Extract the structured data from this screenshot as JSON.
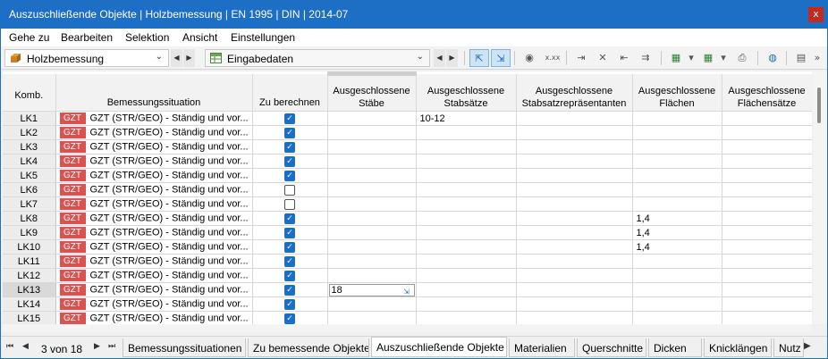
{
  "window": {
    "title": "Auszuschließende Objekte | Holzbemessung | EN 1995 | DIN | 2014-07",
    "close_label": "x"
  },
  "menu": [
    "Gehe zu",
    "Bearbeiten",
    "Selektion",
    "Ansicht",
    "Einstellungen"
  ],
  "toolbar": {
    "module_combo": "Holzbemessung",
    "view_combo": "Eingabedaten",
    "icons": {
      "module": "wood-beam-icon",
      "view": "table-icon",
      "overflow": "»"
    }
  },
  "table": {
    "headers": {
      "komb": "Komb.",
      "situation": "Bemessungssituation",
      "zu_berechnen": "Zu berechnen",
      "staebe": "Ausgeschlossene Stäbe",
      "stabsaetze": "Ausgeschlossene Stabsätze",
      "repraesentanten": "Ausgeschlossene Stabsatzrepräsentanten",
      "flaechen": "Ausgeschlossene Flächen",
      "flaechensaetze": "Ausgeschlossene Flächensätze"
    },
    "rows": [
      {
        "id": "LK1",
        "tag": "GZT",
        "desc": "GZT (STR/GEO) - Ständig und vor...",
        "checked": true,
        "staebe": "",
        "stabsaetze": "10-12",
        "rep": "",
        "flaechen": "",
        "fsaetze": ""
      },
      {
        "id": "LK2",
        "tag": "GZT",
        "desc": "GZT (STR/GEO) - Ständig und vor...",
        "checked": true,
        "staebe": "",
        "stabsaetze": "",
        "rep": "",
        "flaechen": "",
        "fsaetze": ""
      },
      {
        "id": "LK3",
        "tag": "GZT",
        "desc": "GZT (STR/GEO) - Ständig und vor...",
        "checked": true,
        "staebe": "",
        "stabsaetze": "",
        "rep": "",
        "flaechen": "",
        "fsaetze": ""
      },
      {
        "id": "LK4",
        "tag": "GZT",
        "desc": "GZT (STR/GEO) - Ständig und vor...",
        "checked": true,
        "staebe": "",
        "stabsaetze": "",
        "rep": "",
        "flaechen": "",
        "fsaetze": ""
      },
      {
        "id": "LK5",
        "tag": "GZT",
        "desc": "GZT (STR/GEO) - Ständig und vor...",
        "checked": true,
        "staebe": "",
        "stabsaetze": "",
        "rep": "",
        "flaechen": "",
        "fsaetze": ""
      },
      {
        "id": "LK6",
        "tag": "GZT",
        "desc": "GZT (STR/GEO) - Ständig und vor...",
        "checked": false,
        "staebe": "",
        "stabsaetze": "",
        "rep": "",
        "flaechen": "",
        "fsaetze": ""
      },
      {
        "id": "LK7",
        "tag": "GZT",
        "desc": "GZT (STR/GEO) - Ständig und vor...",
        "checked": false,
        "staebe": "",
        "stabsaetze": "",
        "rep": "",
        "flaechen": "",
        "fsaetze": ""
      },
      {
        "id": "LK8",
        "tag": "GZT",
        "desc": "GZT (STR/GEO) - Ständig und vor...",
        "checked": true,
        "staebe": "",
        "stabsaetze": "",
        "rep": "",
        "flaechen": "1,4",
        "fsaetze": ""
      },
      {
        "id": "LK9",
        "tag": "GZT",
        "desc": "GZT (STR/GEO) - Ständig und vor...",
        "checked": true,
        "staebe": "",
        "stabsaetze": "",
        "rep": "",
        "flaechen": "1,4",
        "fsaetze": ""
      },
      {
        "id": "LK10",
        "tag": "GZT",
        "desc": "GZT (STR/GEO) - Ständig und vor...",
        "checked": true,
        "staebe": "",
        "stabsaetze": "",
        "rep": "",
        "flaechen": "1,4",
        "fsaetze": ""
      },
      {
        "id": "LK11",
        "tag": "GZT",
        "desc": "GZT (STR/GEO) - Ständig und vor...",
        "checked": true,
        "staebe": "",
        "stabsaetze": "",
        "rep": "",
        "flaechen": "",
        "fsaetze": ""
      },
      {
        "id": "LK12",
        "tag": "GZT",
        "desc": "GZT (STR/GEO) - Ständig und vor...",
        "checked": true,
        "staebe": "",
        "stabsaetze": "",
        "rep": "",
        "flaechen": "",
        "fsaetze": ""
      },
      {
        "id": "LK13",
        "tag": "GZT",
        "desc": "GZT (STR/GEO) - Ständig und vor...",
        "checked": true,
        "staebe": "18",
        "stabsaetze": "",
        "rep": "",
        "flaechen": "",
        "fsaetze": "",
        "editing": true
      },
      {
        "id": "LK14",
        "tag": "GZT",
        "desc": "GZT (STR/GEO) - Ständig und vor...",
        "checked": true,
        "staebe": "",
        "stabsaetze": "",
        "rep": "",
        "flaechen": "",
        "fsaetze": ""
      },
      {
        "id": "LK15",
        "tag": "GZT",
        "desc": "GZT (STR/GEO) - Ständig und vor...",
        "checked": true,
        "staebe": "",
        "stabsaetze": "",
        "rep": "",
        "flaechen": "",
        "fsaetze": ""
      }
    ]
  },
  "tabs": {
    "page": "3 von 18",
    "items": [
      "Bemessungssituationen",
      "Zu bemessende Objekte",
      "Auszuschließende Objekte",
      "Materialien",
      "Querschnitte",
      "Dicken",
      "Knicklängen",
      "Nutz"
    ],
    "active": "Auszuschließende Objekte"
  },
  "colors": {
    "accent": "#1c6fc4",
    "tag": "#d9534f",
    "checkbox": "#1a6ec9"
  }
}
